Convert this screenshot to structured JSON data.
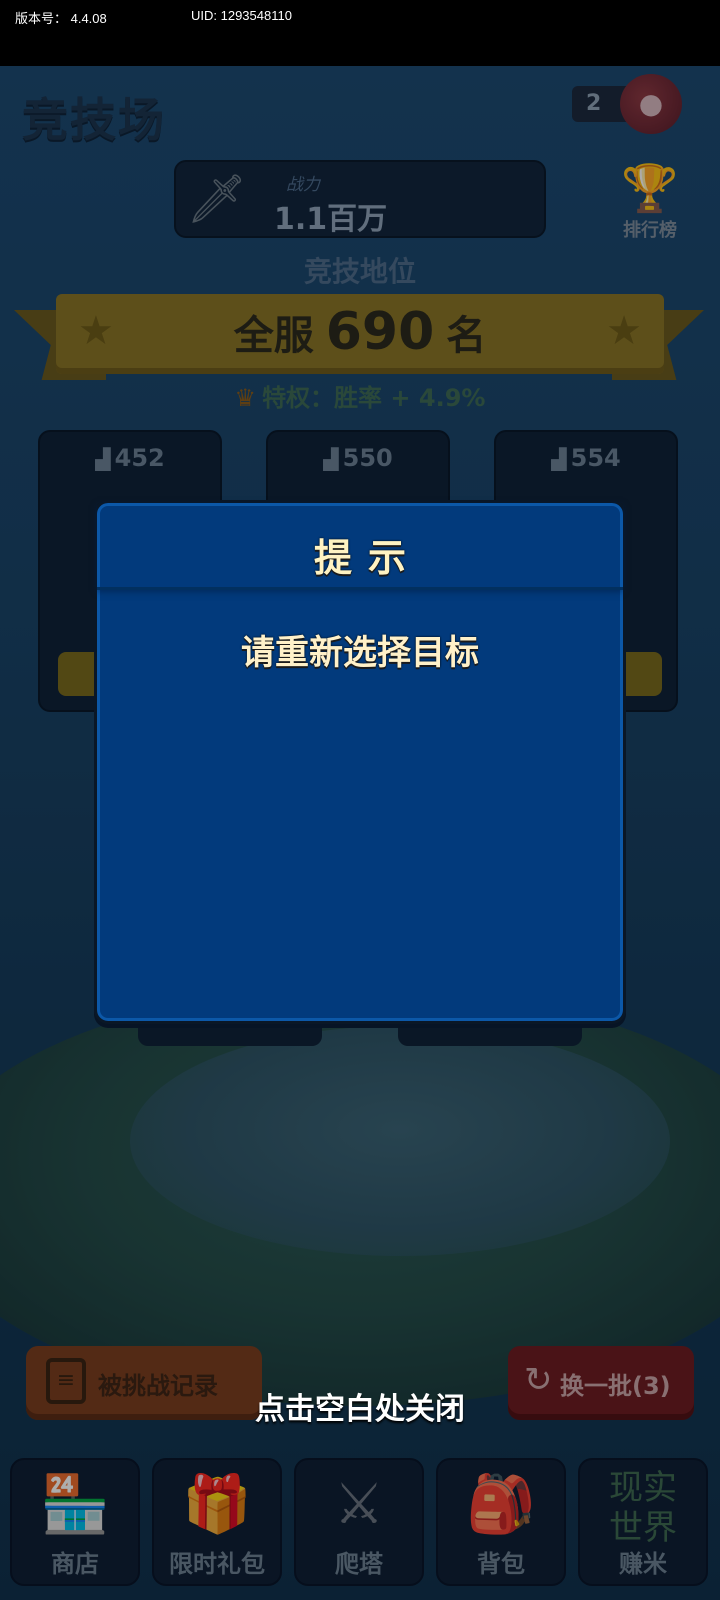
{
  "status_bar": {
    "version": "版本号：  4.4.08",
    "uid": "UID: 1293548110"
  },
  "header": {
    "title": "竞技场",
    "tickets": "2"
  },
  "power": {
    "label": "战力",
    "value": "1.1百万"
  },
  "leaderboard_label": "排行榜",
  "arena_status": {
    "title": "竞技地位",
    "rank_prefix": "全服",
    "rank_number": "690",
    "rank_suffix": "名",
    "privilege": "特权：胜率 + 4.9%"
  },
  "opponents": [
    {
      "rank": "452"
    },
    {
      "rank": "550"
    },
    {
      "rank": "554"
    }
  ],
  "buttons": {
    "challenge_log": "被挑战记录",
    "refresh": "换一批(3)"
  },
  "close_hint": "点击空白处关闭",
  "nav": {
    "shop": "商店",
    "gift": "限时礼包",
    "tower": "爬塔",
    "bag": "背包",
    "earn": "赚米",
    "earn_logo_top": "现实",
    "earn_logo_bottom": "世界"
  },
  "dialog": {
    "title": "提示",
    "message": "请重新选择目标"
  }
}
